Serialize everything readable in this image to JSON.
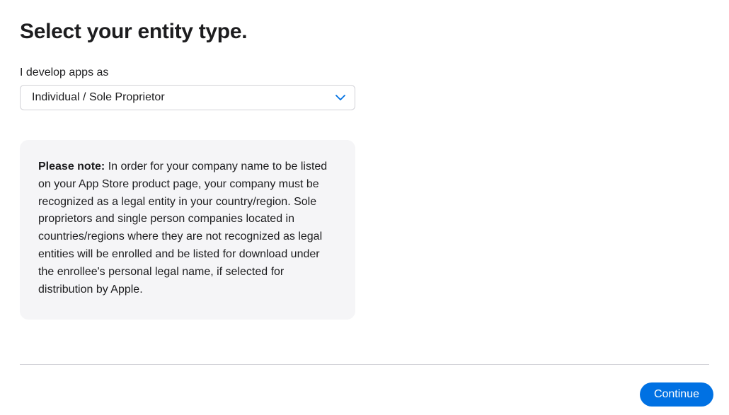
{
  "heading": "Select your entity type.",
  "field": {
    "label": "I develop apps as",
    "selected": "Individual / Sole Proprietor"
  },
  "note": {
    "label": "Please note:",
    "text": " In order for your company name to be listed on your App Store product page, your company must be recognized as a legal entity in your country/region. Sole proprietors and single person companies located in countries/regions where they are not recognized as legal entities will be enrolled and be listed for download under the enrollee's personal legal name, if selected for distribution by Apple."
  },
  "actions": {
    "continue": "Continue"
  }
}
